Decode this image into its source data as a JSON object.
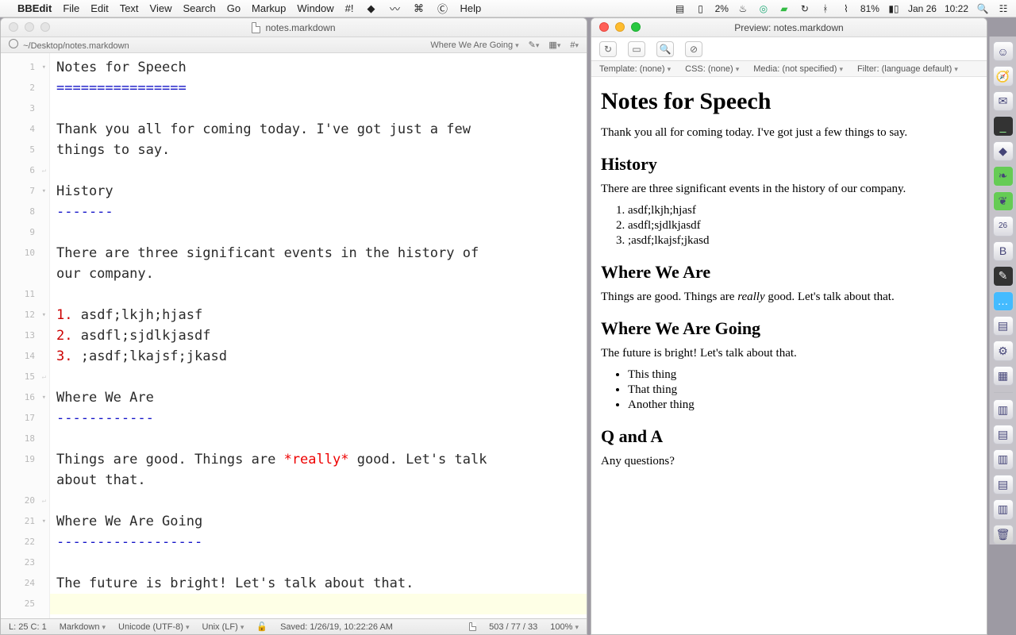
{
  "menubar": {
    "app": "BBEdit",
    "items": [
      "File",
      "Edit",
      "Text",
      "View",
      "Search",
      "Go",
      "Markup",
      "Window",
      "#!",
      "Help"
    ],
    "battery_left": "2%",
    "battery_right": "81%",
    "date": "Jan 26",
    "time": "10:22"
  },
  "editor": {
    "filename": "notes.markdown",
    "path": "~/Desktop/notes.markdown",
    "nav_section": "Where We Are Going",
    "lines": [
      {
        "n": 1,
        "fold": true,
        "t": "Notes for Speech"
      },
      {
        "n": 2,
        "t": "================",
        "cls": "mdh"
      },
      {
        "n": 3,
        "t": ""
      },
      {
        "n": 4,
        "t": "Thank you all for coming today. I've got just a few"
      },
      {
        "n": 5,
        "t": "things to say."
      },
      {
        "n": 6,
        "ret": true,
        "t": ""
      },
      {
        "n": 7,
        "fold": true,
        "t": "History"
      },
      {
        "n": 8,
        "t": "-------",
        "cls": "mdh"
      },
      {
        "n": 9,
        "t": ""
      },
      {
        "n": 10,
        "t": "There are three significant events in the history of"
      },
      {
        "n": "",
        "t": "our company."
      },
      {
        "n": 11,
        "t": ""
      },
      {
        "n": 12,
        "fold": true,
        "li": "1.",
        "t": " asdf;lkjh;hjasf"
      },
      {
        "n": 13,
        "li": "2.",
        "t": " asdfl;sjdlkjasdf"
      },
      {
        "n": 14,
        "li": "3.",
        "t": " ;asdf;lkajsf;jkasd"
      },
      {
        "n": 15,
        "ret": true,
        "t": ""
      },
      {
        "n": 16,
        "fold": true,
        "t": "Where We Are"
      },
      {
        "n": 17,
        "t": "------------",
        "cls": "mdh"
      },
      {
        "n": 18,
        "t": ""
      },
      {
        "n": 19,
        "t": "Things are good. Things are ",
        "em": "*really*",
        "t2": " good. Let's talk"
      },
      {
        "n": "",
        "t": "about that."
      },
      {
        "n": 20,
        "ret": true,
        "t": ""
      },
      {
        "n": 21,
        "fold": true,
        "t": "Where We Are Going"
      },
      {
        "n": 22,
        "t": "------------------",
        "cls": "mdh"
      },
      {
        "n": 23,
        "t": ""
      },
      {
        "n": 24,
        "t": "The future is bright! Let's talk about that."
      },
      {
        "n": 25,
        "t": "",
        "cur": true
      }
    ],
    "status": {
      "pos": "L: 25 C: 1",
      "lang": "Markdown",
      "enc": "Unicode (UTF-8)",
      "lineend": "Unix (LF)",
      "saved": "Saved: 1/26/19, 10:22:26 AM",
      "counts": "503 / 77 / 33",
      "zoom": "100%"
    }
  },
  "preview": {
    "title": "Preview: notes.markdown",
    "filters": {
      "template": "Template: (none)",
      "css": "CSS: (none)",
      "media": "Media: (not specified)",
      "filter": "Filter: (language default)"
    },
    "h1": "Notes for Speech",
    "intro": "Thank you all for coming today. I've got just a few things to say.",
    "h2a": "History",
    "hist_p": "There are three significant events in the history of our company.",
    "ol": [
      "asdf;lkjh;hjasf",
      "asdfl;sjdlkjasdf",
      ";asdf;lkajsf;jkasd"
    ],
    "h2b": "Where We Are",
    "where_p_pre": "Things are good. Things are ",
    "where_em": "really",
    "where_p_post": " good. Let's talk about that.",
    "h2c": "Where We Are Going",
    "going_p": "The future is bright! Let's talk about that.",
    "ul": [
      "This thing",
      "That thing",
      "Another thing"
    ],
    "h2d": "Q and A",
    "qa_p": "Any questions?"
  }
}
